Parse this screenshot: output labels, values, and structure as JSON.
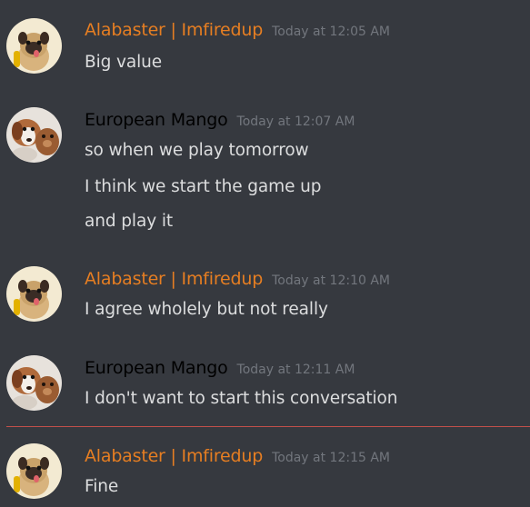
{
  "colors": {
    "background": "#36393f",
    "alabaster_name": "#e67e22",
    "mango_name": "#000000",
    "timestamp": "#72767d",
    "message_text": "#dcddde",
    "new_messages_divider": "#c1504a"
  },
  "messages": [
    {
      "author": "Alabaster | Imfiredup",
      "avatar": "pug-avatar",
      "timestamp": "Today at 12:05 AM",
      "lines": [
        "Big value"
      ]
    },
    {
      "author": "European Mango",
      "avatar": "puppy-avatar",
      "timestamp": "Today at 12:07 AM",
      "lines": [
        "so when we play tomorrow",
        "I think we start the game up",
        "and play it"
      ]
    },
    {
      "author": "Alabaster | Imfiredup",
      "avatar": "pug-avatar",
      "timestamp": "Today at 12:10 AM",
      "lines": [
        "I agree wholely but not really"
      ]
    },
    {
      "author": "European Mango",
      "avatar": "puppy-avatar",
      "timestamp": "Today at 12:11 AM",
      "lines": [
        "I don't want to start this conversation"
      ]
    },
    {
      "author": "Alabaster | Imfiredup",
      "avatar": "pug-avatar",
      "timestamp": "Today at 12:15 AM",
      "lines": [
        "Fine"
      ]
    }
  ]
}
